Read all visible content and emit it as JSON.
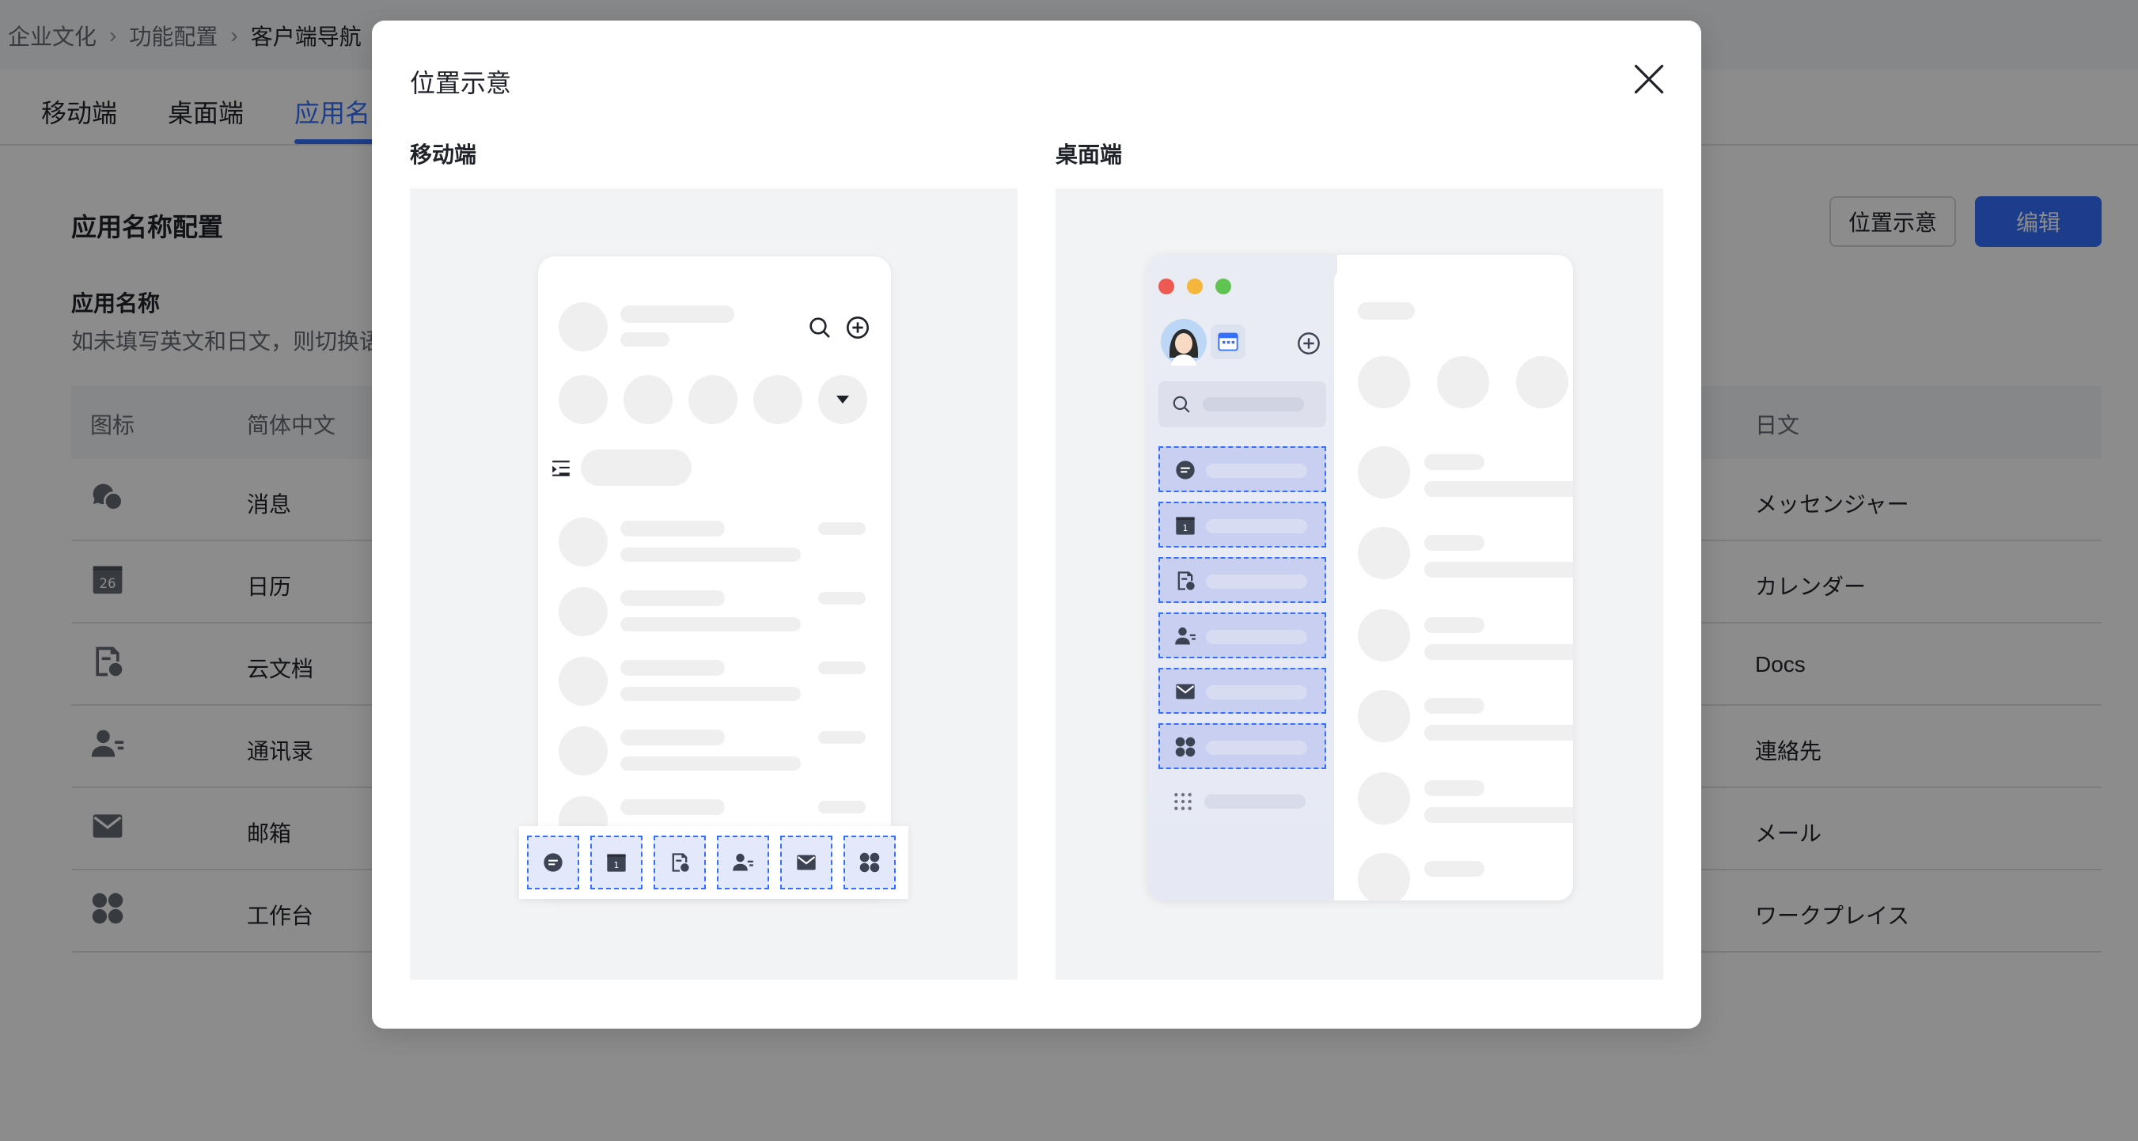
{
  "breadcrumb": [
    "企业文化",
    "功能配置",
    "客户端导航"
  ],
  "tabs": [
    "移动端",
    "桌面端",
    "应用名"
  ],
  "section_title": "应用名称配置",
  "buttons": {
    "location_hint": "位置示意",
    "edit": "编辑"
  },
  "field": {
    "label": "应用名称",
    "description": "如未填写英文和日文，则切换语"
  },
  "table": {
    "headers": {
      "icon": "图标",
      "zh": "简体中文",
      "ja": "日文"
    },
    "rows": [
      {
        "icon": "message-icon",
        "zh": "消息",
        "ja": "メッセンジャー"
      },
      {
        "icon": "calendar-icon",
        "zh": "日历",
        "ja": "カレンダー",
        "icon_text": "26"
      },
      {
        "icon": "docs-icon",
        "zh": "云文档",
        "ja": "Docs"
      },
      {
        "icon": "contacts-icon",
        "zh": "通讯录",
        "ja": "連絡先"
      },
      {
        "icon": "mail-icon",
        "zh": "邮箱",
        "ja": "メール"
      },
      {
        "icon": "workplace-icon",
        "zh": "工作台",
        "ja": "ワークプレイス"
      }
    ]
  },
  "modal": {
    "title": "位置示意",
    "mobile_label": "移动端",
    "desktop_label": "桌面端"
  },
  "mockup": {
    "calendar_glyph": "1",
    "window_dots": [
      "#ee5a52",
      "#f5b73b",
      "#5fc451"
    ]
  },
  "colors": {
    "accent": "#3370ff",
    "highlight_fill": "#e3e8fa"
  }
}
